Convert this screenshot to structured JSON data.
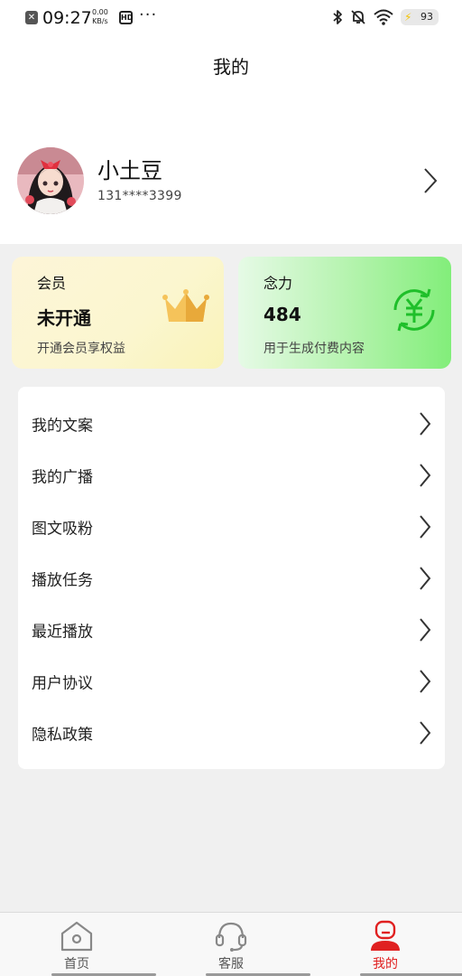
{
  "status_bar": {
    "time": "09:27",
    "net_speed_value": "0.00",
    "net_speed_unit": "KB/s",
    "hd_badge": "HD",
    "more": "···",
    "battery": "93"
  },
  "header": {
    "title": "我的"
  },
  "profile": {
    "name": "小土豆",
    "phone": "131****3399"
  },
  "cards": {
    "member": {
      "title": "会员",
      "value": "未开通",
      "subtitle": "开通会员享权益",
      "icon": "crown-icon"
    },
    "power": {
      "title": "念力",
      "value": "484",
      "subtitle": "用于生成付费内容",
      "icon": "yuan-coin-icon"
    }
  },
  "menu": {
    "items": [
      {
        "label": "我的文案"
      },
      {
        "label": "我的广播"
      },
      {
        "label": "图文吸粉"
      },
      {
        "label": "播放任务"
      },
      {
        "label": "最近播放"
      },
      {
        "label": "用户协议"
      },
      {
        "label": "隐私政策"
      }
    ]
  },
  "tabbar": {
    "tabs": [
      {
        "label": "首页",
        "icon": "home-icon"
      },
      {
        "label": "客服",
        "icon": "headset-icon"
      },
      {
        "label": "我的",
        "icon": "profile-icon"
      }
    ],
    "active_color": "#e02020"
  }
}
